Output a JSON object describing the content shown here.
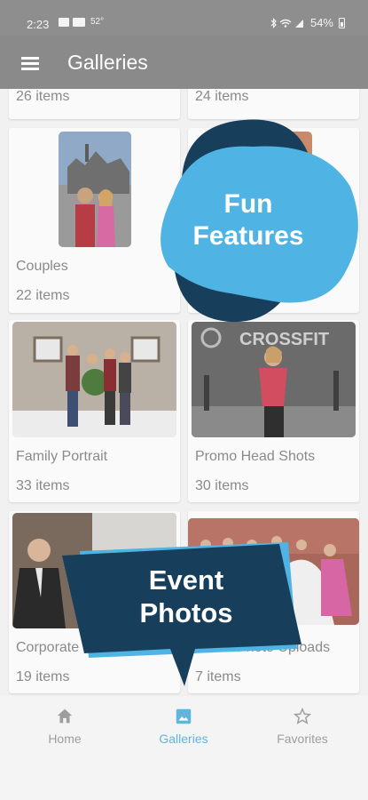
{
  "status_bar": {
    "time": "2:23",
    "temperature": "52°",
    "battery": "54%"
  },
  "app_bar": {
    "title": "Galleries"
  },
  "galleries": [
    {
      "name": "",
      "count": "26 items"
    },
    {
      "name": "",
      "count": "24 items"
    },
    {
      "name": "Couples",
      "count": "22 items"
    },
    {
      "name": "",
      "count": ""
    },
    {
      "name": "Family Portrait",
      "count": "33 items"
    },
    {
      "name": "Promo Head Shots",
      "count": "30 items"
    },
    {
      "name": "Corporate Meetings",
      "count": "19 items"
    },
    {
      "name": "Guest Photo Uploads",
      "count": "7 items"
    }
  ],
  "overlays": {
    "fun_features": "Fun Features",
    "event_photos": "Event Photos"
  },
  "bottom_nav": [
    {
      "label": "Home",
      "icon": "home-icon"
    },
    {
      "label": "Galleries",
      "icon": "image-icon",
      "active": true
    },
    {
      "label": "Favorites",
      "icon": "star-icon"
    }
  ],
  "colors": {
    "accent": "#5eb6df",
    "bubble_light": "#4fb3e3",
    "bubble_dark": "#173f5c",
    "appbar": "#8a8a8a"
  }
}
